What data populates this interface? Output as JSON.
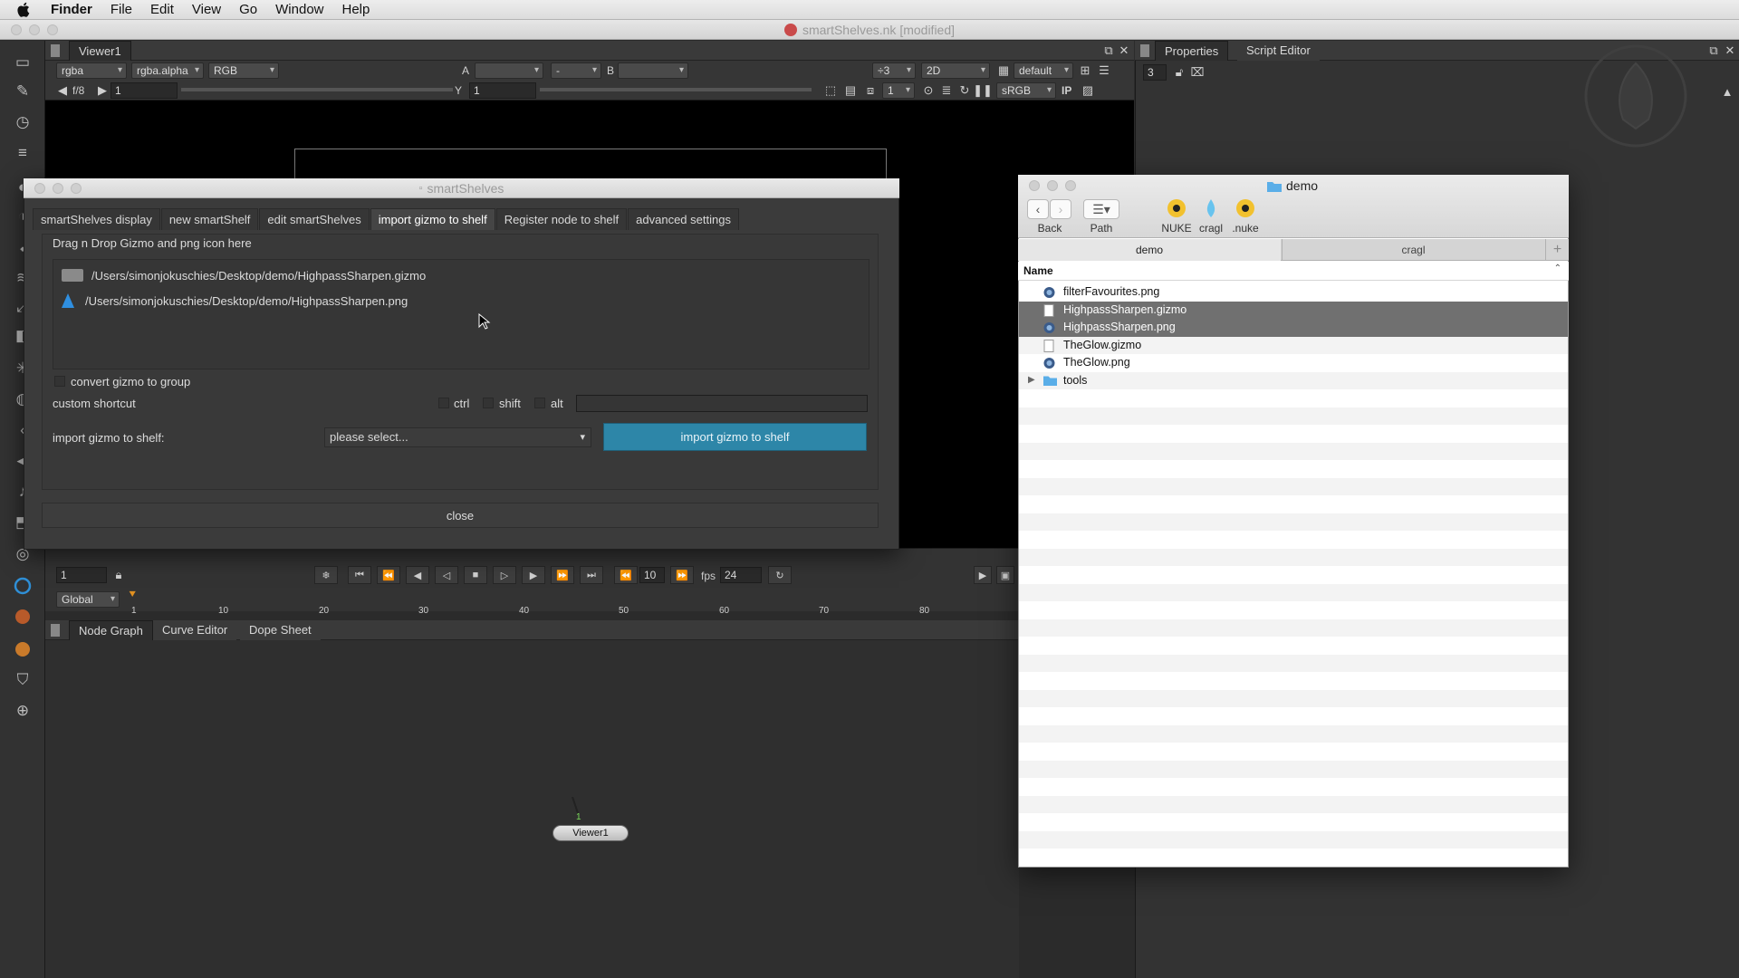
{
  "menubar": {
    "app": "Finder",
    "items": [
      "File",
      "Edit",
      "View",
      "Go",
      "Window",
      "Help"
    ]
  },
  "nuke_window": {
    "title": "smartShelves.nk [modified]"
  },
  "viewer": {
    "tab": "Viewer1",
    "channels": "rgba",
    "alpha": "rgba.alpha",
    "display": "RGB",
    "a_label": "A",
    "dash": "-",
    "b_label": "B",
    "downrez": "÷3",
    "mode": "2D",
    "lut": "default",
    "fstop": "f/8",
    "frame_value": "1",
    "y_label": "Y",
    "y_value": "1",
    "proxy": "1",
    "colorspace": "sRGB",
    "ip": "IP"
  },
  "properties": {
    "tabs": [
      "Properties",
      "Script Editor"
    ],
    "max_panels": "3"
  },
  "timeline": {
    "frame": "1",
    "range": "Global",
    "step": "10",
    "fps_label": "fps",
    "fps": "24",
    "ticks": [
      "1",
      "10",
      "20",
      "30",
      "40",
      "50",
      "60",
      "70",
      "80"
    ]
  },
  "node_graph": {
    "tabs": [
      "Node Graph",
      "Curve Editor",
      "Dope Sheet"
    ],
    "node_label": "Viewer1",
    "node_badge": "1"
  },
  "smartshelves": {
    "title": "smartShelves",
    "tabs": [
      "smartShelves display",
      "new smartShelf",
      "edit smartShelves",
      "import gizmo to shelf",
      "Register node to shelf",
      "advanced settings"
    ],
    "drop_label": "Drag n Drop Gizmo and png icon here",
    "gizmo_path": "/Users/simonjokuschies/Desktop/demo/HighpassSharpen.gizmo",
    "png_path": "/Users/simonjokuschies/Desktop/demo/HighpassSharpen.png",
    "convert_label": "convert gizmo to group",
    "shortcut_label": "custom shortcut",
    "ctrl_label": "ctrl",
    "shift_label": "shift",
    "alt_label": "alt",
    "import_label": "import gizmo to shelf:",
    "select_placeholder": "please select...",
    "import_button": "import gizmo to shelf",
    "close_button": "close"
  },
  "finder": {
    "title": "demo",
    "back_label": "Back",
    "path_label": "Path",
    "favorites": [
      "NUKE",
      "cragl",
      ".nuke"
    ],
    "tabs": [
      "demo",
      "cragl"
    ],
    "column_name": "Name",
    "files": [
      {
        "name": "filterFavourites.png",
        "icon": "png-icon"
      },
      {
        "name": "HighpassSharpen.gizmo",
        "icon": "document-icon"
      },
      {
        "name": "HighpassSharpen.png",
        "icon": "png-icon"
      },
      {
        "name": "TheGlow.gizmo",
        "icon": "document-icon"
      },
      {
        "name": "TheGlow.png",
        "icon": "png-icon"
      },
      {
        "name": "tools",
        "icon": "folder-icon"
      }
    ],
    "selected_files": [
      "HighpassSharpen.gizmo",
      "HighpassSharpen.png"
    ]
  },
  "colors": {
    "accent_button": "#2d86a8",
    "selection": "#707070",
    "folder": "#5aaee8"
  }
}
